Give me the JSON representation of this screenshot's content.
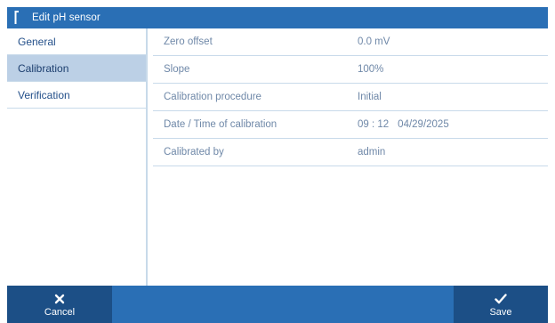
{
  "window": {
    "title": "Edit pH sensor"
  },
  "sidebar": {
    "items": [
      {
        "label": "General"
      },
      {
        "label": "Calibration"
      },
      {
        "label": "Verification"
      }
    ],
    "selected": "Calibration"
  },
  "details": {
    "rows": [
      {
        "label": "Zero offset",
        "value": "0.0 mV"
      },
      {
        "label": "Slope",
        "value": "100%"
      },
      {
        "label": "Calibration procedure",
        "value": "Initial"
      },
      {
        "label": "Date / Time of calibration",
        "time": "09 : 12",
        "date": "04/29/2025"
      },
      {
        "label": "Calibrated by",
        "value": "admin"
      }
    ]
  },
  "footer": {
    "cancel_label": "Cancel",
    "save_label": "Save",
    "cancel_icon": "close-icon",
    "save_icon": "checkmark-icon"
  },
  "colors": {
    "accent": "#2a6fb5",
    "accent_dark": "#1c4f86",
    "selected_row": "#bcd0e6",
    "divider": "#c8daea"
  }
}
